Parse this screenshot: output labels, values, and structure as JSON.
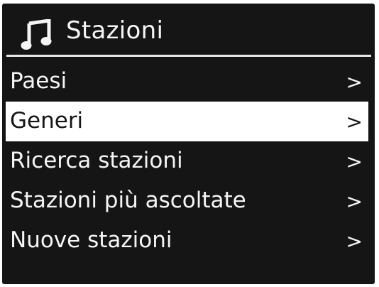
{
  "header": {
    "icon": "music-note-icon",
    "title": "Stazioni"
  },
  "menu": {
    "selected_index": 1,
    "items": [
      {
        "label": "Paesi",
        "arrow": ">"
      },
      {
        "label": "Generi",
        "arrow": ">"
      },
      {
        "label": "Ricerca stazioni",
        "arrow": ">"
      },
      {
        "label": "Stazioni più ascoltate",
        "arrow": ">"
      },
      {
        "label": "Nuove stazioni",
        "arrow": ">"
      }
    ]
  },
  "colors": {
    "background": "#151515",
    "text": "#f5f5f5",
    "highlight": "#ffffff",
    "highlight_text": "#151515"
  }
}
